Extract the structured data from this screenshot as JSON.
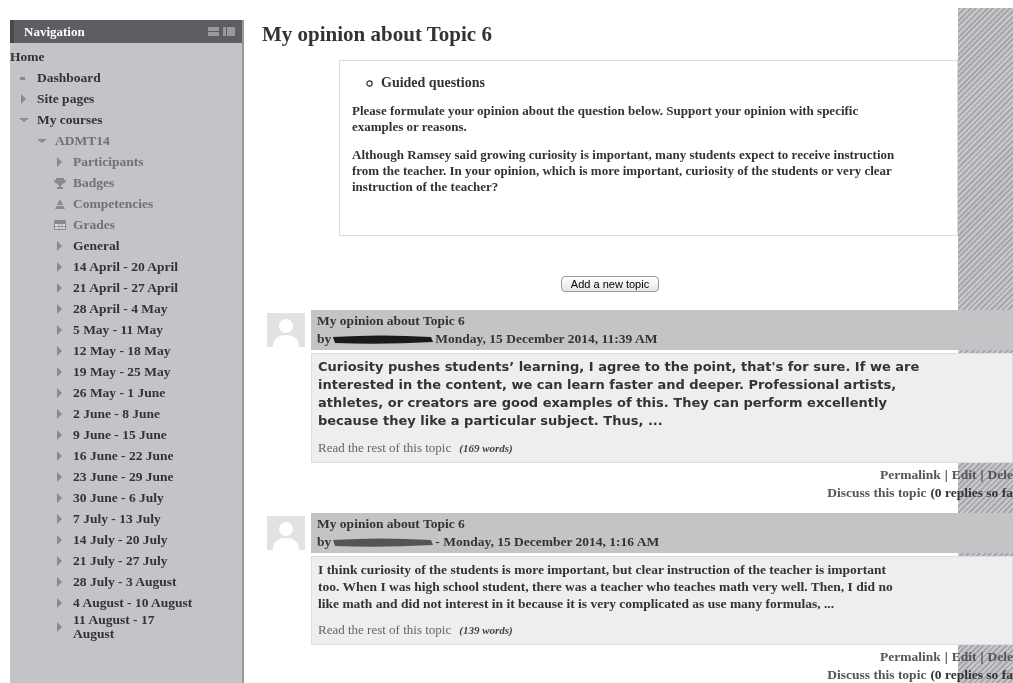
{
  "sidebar": {
    "title": "Navigation",
    "items": [
      {
        "kind": "plain",
        "label": "Home",
        "dimmed": false
      },
      {
        "kind": "leaf",
        "label": "Dashboard",
        "dimmed": false
      },
      {
        "kind": "branch",
        "label": "Site pages",
        "expanded": false,
        "dimmed": false
      },
      {
        "kind": "branch",
        "label": "My courses",
        "expanded": true,
        "dimmed": false,
        "children": [
          {
            "kind": "branch",
            "label": "ADMT14",
            "expanded": true,
            "dimmed": true,
            "children": [
              {
                "kind": "branch",
                "label": "Participants",
                "expanded": false,
                "dimmed": true
              },
              {
                "kind": "badges",
                "label": "Badges",
                "dimmed": true
              },
              {
                "kind": "competencies",
                "label": "Competencies",
                "dimmed": true
              },
              {
                "kind": "grades",
                "label": "Grades",
                "dimmed": true
              },
              {
                "kind": "branch",
                "label": "General",
                "expanded": false,
                "dimmed": false
              },
              {
                "kind": "branch",
                "label": "14 April - 20 April",
                "expanded": false,
                "dimmed": false
              },
              {
                "kind": "branch",
                "label": "21 April - 27 April",
                "expanded": false,
                "dimmed": false
              },
              {
                "kind": "branch",
                "label": "28 April - 4 May",
                "expanded": false,
                "dimmed": false
              },
              {
                "kind": "branch",
                "label": "5 May - 11 May",
                "expanded": false,
                "dimmed": false
              },
              {
                "kind": "branch",
                "label": "12 May - 18 May",
                "expanded": false,
                "dimmed": false
              },
              {
                "kind": "branch",
                "label": "19 May - 25 May",
                "expanded": false,
                "dimmed": false
              },
              {
                "kind": "branch",
                "label": "26 May - 1 June",
                "expanded": false,
                "dimmed": false
              },
              {
                "kind": "branch",
                "label": "2 June - 8 June",
                "expanded": false,
                "dimmed": false
              },
              {
                "kind": "branch",
                "label": "9 June - 15 June",
                "expanded": false,
                "dimmed": false
              },
              {
                "kind": "branch",
                "label": "16 June - 22 June",
                "expanded": false,
                "dimmed": false
              },
              {
                "kind": "branch",
                "label": "23 June - 29 June",
                "expanded": false,
                "dimmed": false
              },
              {
                "kind": "branch",
                "label": "30 June - 6 July",
                "expanded": false,
                "dimmed": false
              },
              {
                "kind": "branch",
                "label": "7 July - 13 July",
                "expanded": false,
                "dimmed": false
              },
              {
                "kind": "branch",
                "label": "14 July - 20 July",
                "expanded": false,
                "dimmed": false
              },
              {
                "kind": "branch",
                "label": "21 July - 27 July",
                "expanded": false,
                "dimmed": false
              },
              {
                "kind": "branch",
                "label": "28 July - 3 August",
                "expanded": false,
                "dimmed": false
              },
              {
                "kind": "branch",
                "label": "4 August - 10 August",
                "expanded": false,
                "dimmed": false
              },
              {
                "kind": "branch",
                "label": "11 August - 17 August",
                "expanded": false,
                "dimmed": false
              }
            ]
          }
        ]
      }
    ]
  },
  "page": {
    "title": "My opinion about Topic 6",
    "intro": {
      "heading": "Guided questions",
      "paragraphs": [
        "Please formulate your opinion about the question below. Support your opinion with  specific examples or reasons.",
        "Although Ramsey said growing curiosity is important, many students expect to receive instruction from the teacher. In your opinion, which is more important, curiosity of the students or very clear instruction of the teacher?"
      ]
    },
    "add_button": "Add a new topic",
    "posts": [
      {
        "kind": "sans",
        "subject": "My opinion about Topic 6",
        "by": "by",
        "date": "Monday, 15 December 2014, 11:39 AM",
        "body_lines": [
          "Curiosity pushes students’ learning, I agree to the point, that's for sure. If we are",
          "interested in the content, we can learn faster and deeper. Professional artists,",
          "athletes, or creators are good examples of this. They can perform excellently",
          "because they like a particular subject. Thus, ..."
        ],
        "read_more": "Read the rest of this topic",
        "word_count": "(169 words)",
        "links": [
          "Permalink",
          "Edit",
          "Dele"
        ],
        "separator": "|",
        "discuss": "Discuss this topic",
        "replies": "(0 replies so fa"
      },
      {
        "kind": "serif",
        "subject": "My opinion about Topic 6",
        "by": "by",
        "date": "- Monday, 15 December 2014, 1:16 AM",
        "body_lines": [
          "I think curiosity of the students is more important, but clear instruction of the teacher is important",
          "too. When I was high school student, there was a teacher who teaches math very well. Then, I did no",
          "like math and did not interest in it because it is very complicated as use many formulas, ..."
        ],
        "read_more": "Read the rest of this topic",
        "word_count": "(139 words)",
        "links": [
          "Permalink",
          "Edit",
          "Dele"
        ],
        "separator": "|",
        "discuss": "Discuss this topic",
        "replies": "(0 replies so fa"
      }
    ]
  }
}
